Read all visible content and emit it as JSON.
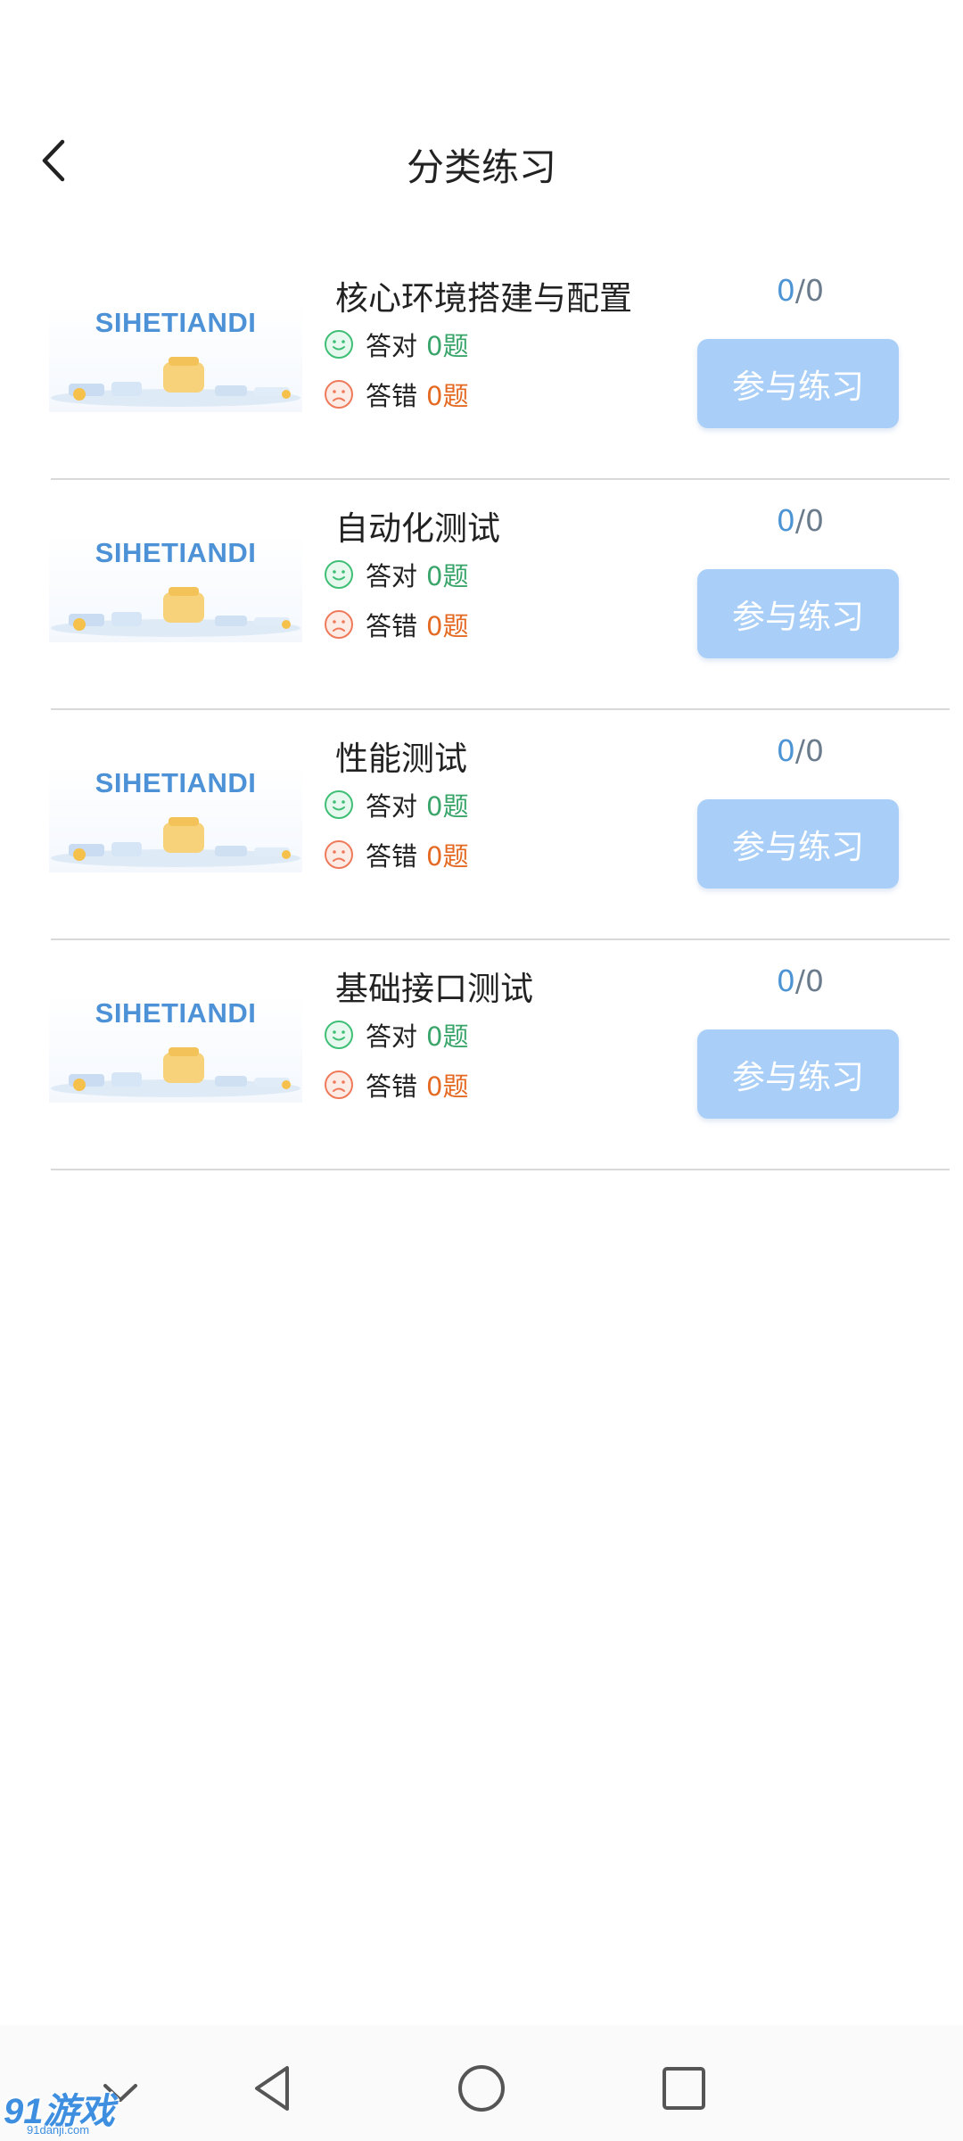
{
  "header": {
    "title": "分类练习"
  },
  "categories": [
    {
      "thumb_brand": "SIHETIANDI",
      "title": "核心环境搭建与配置",
      "correct_label": "答对",
      "correct_count": "0题",
      "wrong_label": "答错",
      "wrong_count": "0题",
      "progress_done": "0",
      "progress_total": "/0",
      "button_label": "参与练习"
    },
    {
      "thumb_brand": "SIHETIANDI",
      "title": "自动化测试",
      "correct_label": "答对",
      "correct_count": "0题",
      "wrong_label": "答错",
      "wrong_count": "0题",
      "progress_done": "0",
      "progress_total": "/0",
      "button_label": "参与练习"
    },
    {
      "thumb_brand": "SIHETIANDI",
      "title": "性能测试",
      "correct_label": "答对",
      "correct_count": "0题",
      "wrong_label": "答错",
      "wrong_count": "0题",
      "progress_done": "0",
      "progress_total": "/0",
      "button_label": "参与练习"
    },
    {
      "thumb_brand": "SIHETIANDI",
      "title": "基础接口测试",
      "correct_label": "答对",
      "correct_count": "0题",
      "wrong_label": "答错",
      "wrong_count": "0题",
      "progress_done": "0",
      "progress_total": "/0",
      "button_label": "参与练习"
    }
  ],
  "watermark": {
    "brand": "91游戏",
    "url": "91danji.com"
  },
  "colors": {
    "button_bg": "#a9cff8",
    "correct": "#3aa56a",
    "wrong": "#e46a23",
    "brand_blue": "#4d92d6"
  },
  "icons": [
    "back-arrow-icon",
    "smile-face-icon",
    "sad-face-icon",
    "nav-hide-icon",
    "nav-back-icon",
    "nav-home-icon",
    "nav-recent-icon"
  ]
}
